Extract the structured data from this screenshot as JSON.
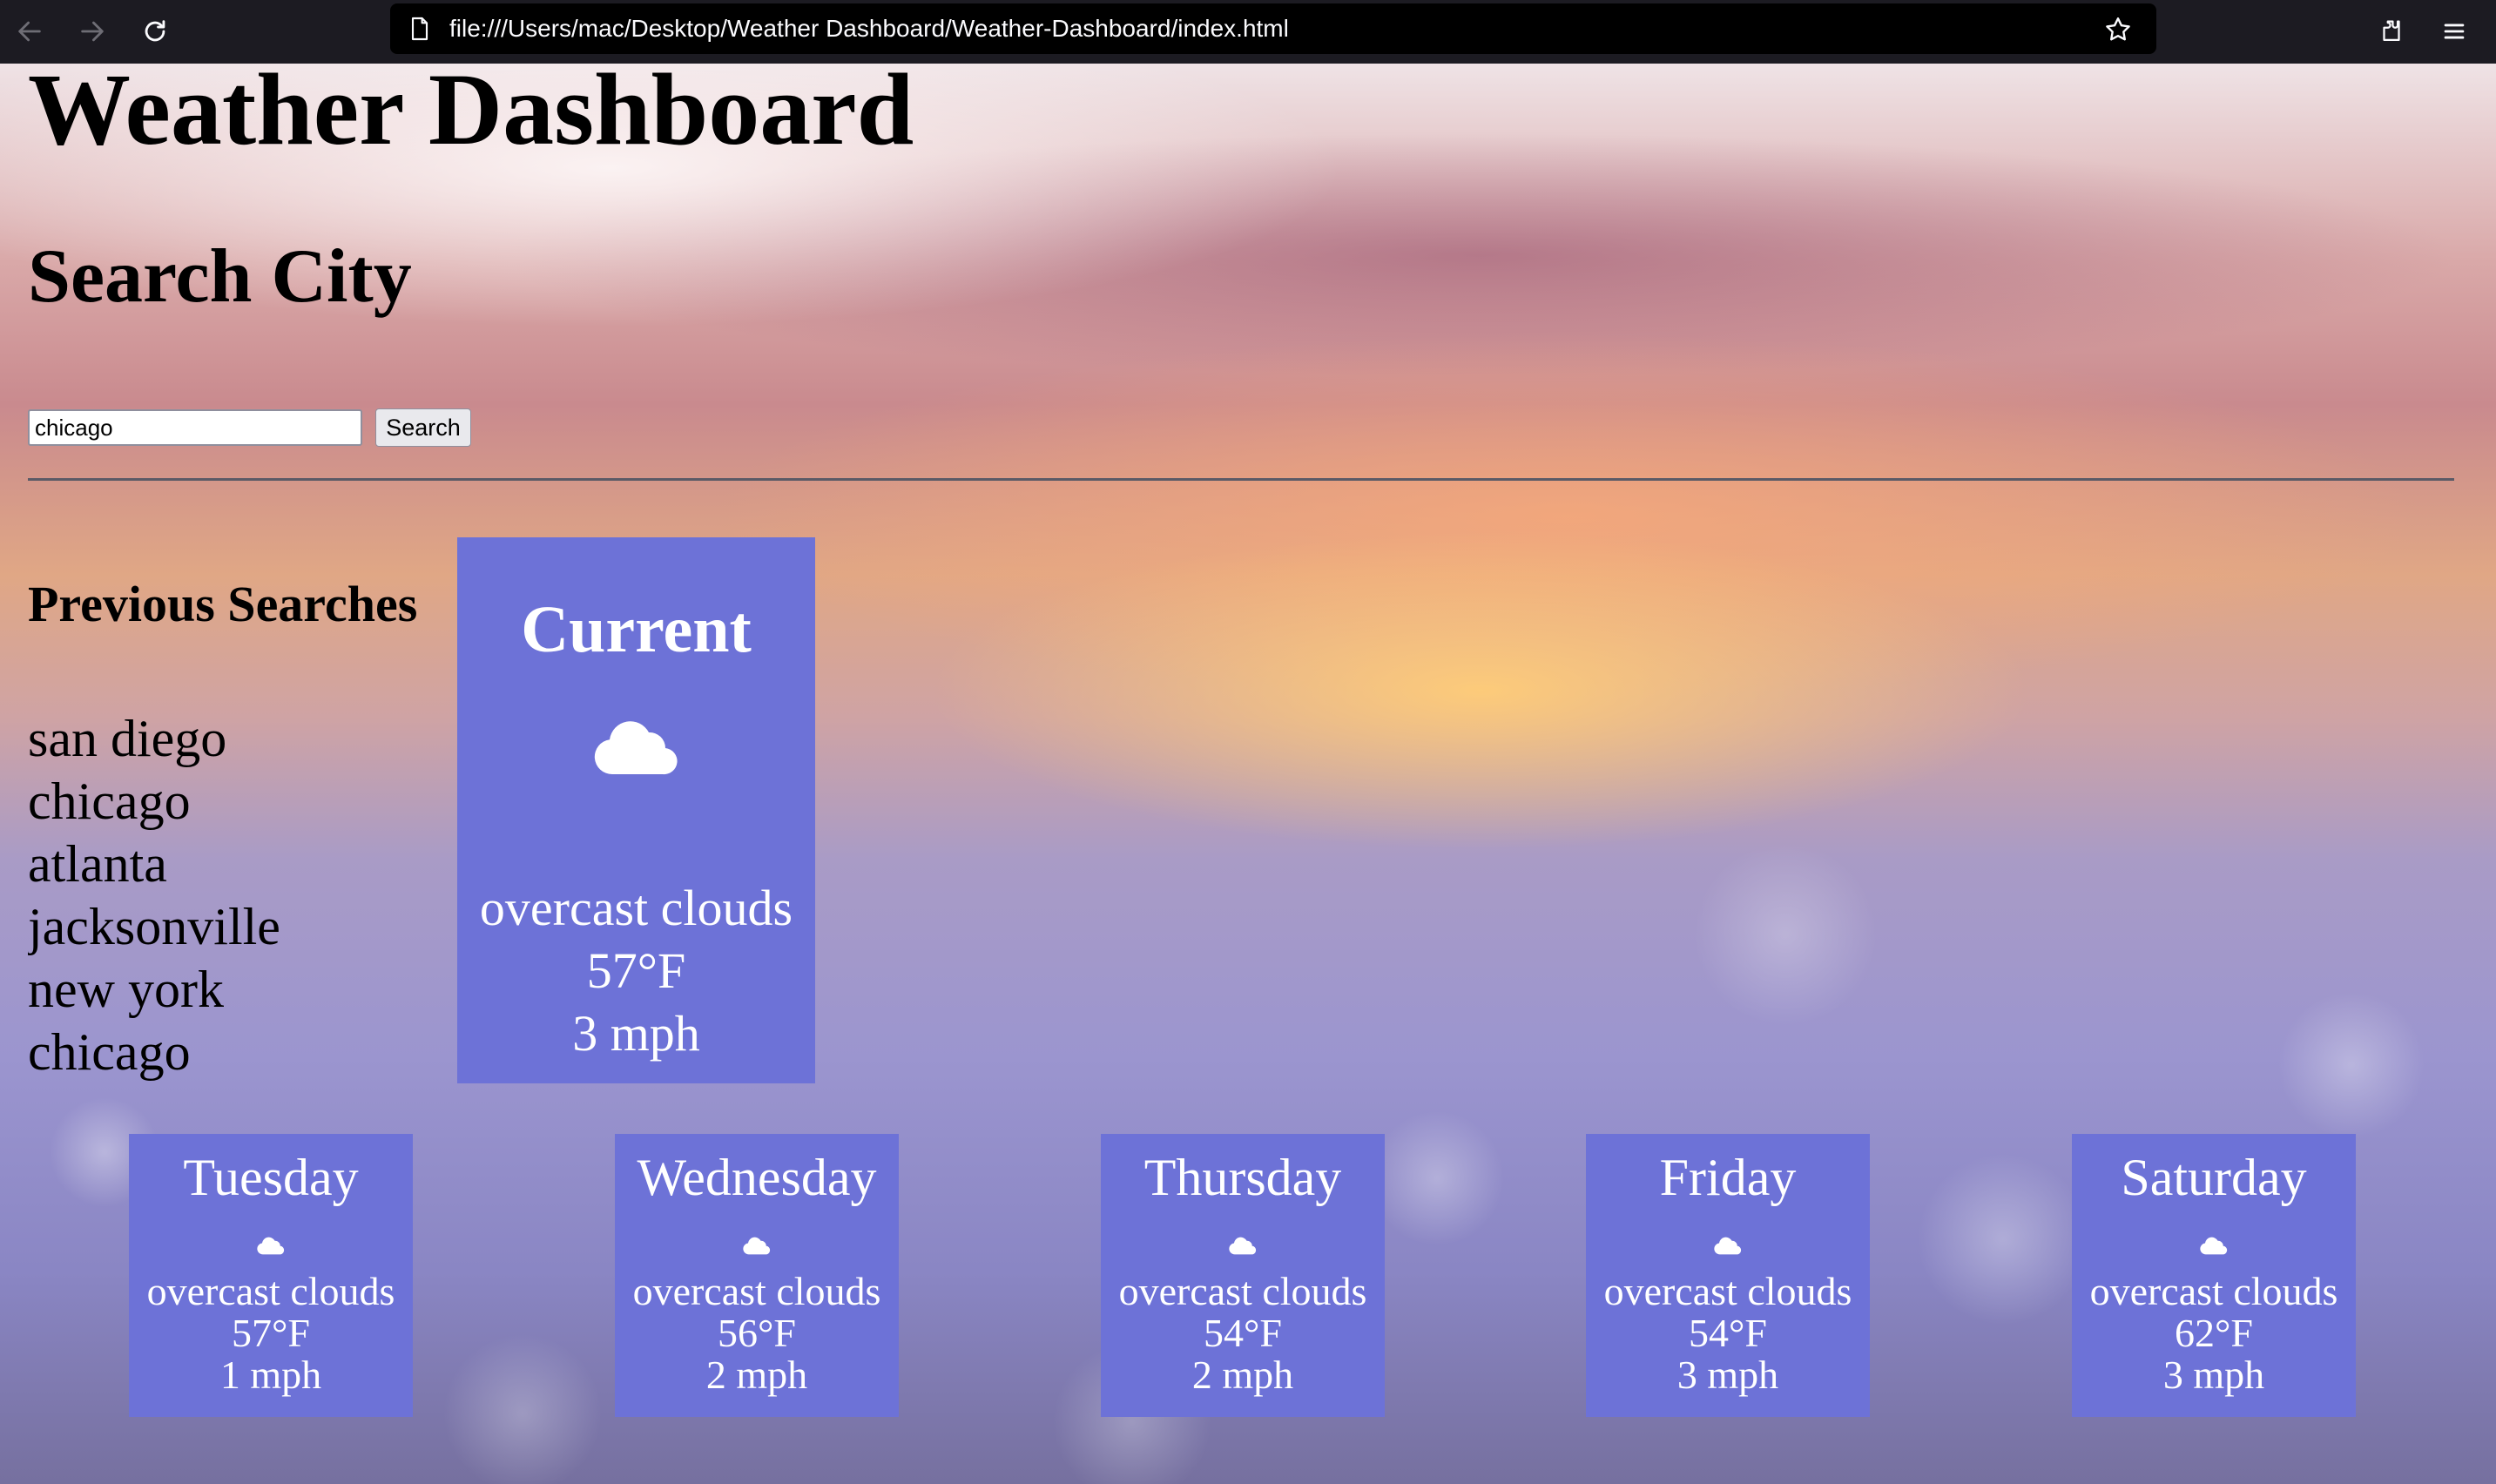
{
  "browser": {
    "url": "file:///Users/mac/Desktop/Weather Dashboard/Weather-Dashboard/index.html",
    "icons": [
      "back-arrow-icon",
      "forward-arrow-icon",
      "reload-icon",
      "page-icon",
      "bookmark-star-icon",
      "extensions-icon",
      "menu-icon"
    ]
  },
  "page": {
    "title": "Weather Dashboard",
    "search": {
      "heading": "Search City",
      "input_value": "chicago",
      "button_label": "Search"
    },
    "previous": {
      "heading": "Previous Searches",
      "items": [
        "san diego",
        "chicago",
        "atlanta",
        "jacksonville",
        "new york",
        "chicago"
      ]
    },
    "current": {
      "title": "Current",
      "icon": "cloud-icon",
      "description": "overcast clouds",
      "temp": "57°F",
      "wind": "3 mph"
    },
    "forecast": [
      {
        "day": "Tuesday",
        "icon": "cloud-icon",
        "description": "overcast clouds",
        "temp": "57°F",
        "wind": "1 mph"
      },
      {
        "day": "Wednesday",
        "icon": "cloud-icon",
        "description": "overcast clouds",
        "temp": "56°F",
        "wind": "2 mph"
      },
      {
        "day": "Thursday",
        "icon": "cloud-icon",
        "description": "overcast clouds",
        "temp": "54°F",
        "wind": "2 mph"
      },
      {
        "day": "Friday",
        "icon": "cloud-icon",
        "description": "overcast clouds",
        "temp": "54°F",
        "wind": "3 mph"
      },
      {
        "day": "Saturday",
        "icon": "cloud-icon",
        "description": "overcast clouds",
        "temp": "62°F",
        "wind": "3 mph"
      }
    ],
    "colors": {
      "card_background": "#6d72d7",
      "card_text": "#ffffff",
      "chrome_background": "#1c1b22"
    }
  }
}
